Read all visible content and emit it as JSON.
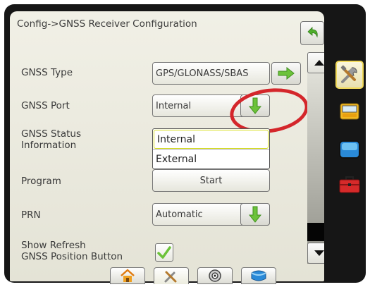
{
  "header": {
    "title": "Config->GNSS Receiver Configuration"
  },
  "settings": {
    "gnss_type": {
      "label": "GNSS Type",
      "value": "GPS/GLONASS/SBAS"
    },
    "gnss_port": {
      "label": "GNSS Port",
      "value": "Internal",
      "options": [
        "Internal",
        "External"
      ]
    },
    "gnss_status": {
      "label_line1": "GNSS Status",
      "label_line2": "Information"
    },
    "program": {
      "label": "Program",
      "button": "Start"
    },
    "prn": {
      "label": "PRN",
      "value": "Automatic"
    },
    "show_refresh": {
      "label_line1": "Show Refresh",
      "label_line2": "GNSS Position Button",
      "checked": true
    }
  },
  "icons": {
    "back": "back-arrow-icon",
    "right": "green-right-arrow-icon",
    "down": "green-down-arrow-icon",
    "scroll_up": "up-triangle-icon",
    "scroll_down": "down-triangle-icon",
    "tools": "tools-icon",
    "console": "console-icon",
    "screen": "blue-screen-icon",
    "toolbox": "toolbox-icon",
    "home": "home-icon",
    "target": "target-icon",
    "data": "data-icon"
  },
  "colors": {
    "accent_green": "#6cc23a",
    "highlight_ring": "#d4262b",
    "selection": "#d7df22"
  }
}
